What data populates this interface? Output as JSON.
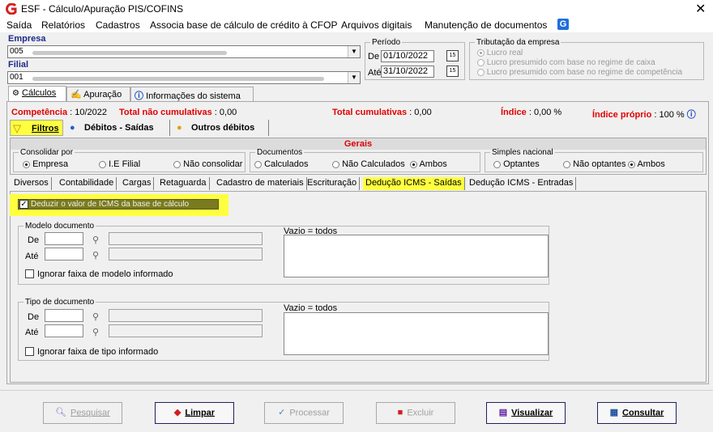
{
  "window": {
    "title": "ESF - Cálculo/Apuração PIS/COFINS",
    "close": "✕"
  },
  "menu": [
    "Saída",
    "Relatórios",
    "Cadastros",
    "Associa base de cálculo de crédito à CFOP",
    "Arquivos digitais",
    "Manutenção de documentos"
  ],
  "empresa": {
    "label": "Empresa",
    "value": "005"
  },
  "filial": {
    "label": "Filial",
    "value": "001"
  },
  "periodo": {
    "legend": "Período",
    "de_label": "De",
    "de_value": "01/10/2022",
    "ate_label": "Até",
    "ate_value": "31/10/2022"
  },
  "tributacao": {
    "legend": "Tributação da empresa",
    "options": [
      "Lucro real",
      "Lucro presumido com base no regime de caixa",
      "Lucro presumido com base no regime de competência"
    ],
    "selected": 0
  },
  "main_tabs": [
    "Cálculos",
    "Apuração",
    "Informações do sistema"
  ],
  "summary": {
    "competencia_label": "Competência",
    "competencia_value": ": 10/2022",
    "tnc_label": "Total não cumulativas",
    "tnc_value": ": 0,00",
    "tc_label": "Total cumulativas",
    "tc_value": ": 0,00",
    "indice_label": "Índice",
    "indice_value": ": 0,00 %",
    "indice_proprio_label": "Índice próprio",
    "indice_proprio_value": ": 100 %"
  },
  "sub_tabs": [
    "Filtros",
    "Débitos - Saídas",
    "Outros débitos"
  ],
  "gerais": {
    "header": "Gerais",
    "consolidar": {
      "legend": "Consolidar por",
      "options": [
        "Empresa",
        "I.E Filial",
        "Não consolidar"
      ],
      "selected": 0
    },
    "documentos": {
      "legend": "Documentos",
      "options": [
        "Calculados",
        "Não Calculados",
        "Ambos"
      ],
      "selected": 2
    },
    "simples": {
      "legend": "Simples nacional",
      "options": [
        "Optantes",
        "Não optantes",
        "Ambos"
      ],
      "selected": 2
    }
  },
  "filter_tabs": [
    "Diversos",
    "Contabilidade",
    "Cargas",
    "Retaguarda",
    "Cadastro de materiais",
    "Escrituração",
    "Dedução ICMS - Saídas",
    "Dedução ICMS - Entradas"
  ],
  "deduzir_checkbox": {
    "label": "Deduzir o valor de ICMS da base de cálculo",
    "checked": true
  },
  "modelo": {
    "legend": "Modelo documento",
    "de": "De",
    "ate": "Até",
    "vazio": "Vazio = todos",
    "ignorar": "Ignorar faixa de modelo informado"
  },
  "tipo": {
    "legend": "Tipo de documento",
    "de": "De",
    "ate": "Até",
    "vazio": "Vazio = todos",
    "ignorar": "Ignorar faixa de tipo informado"
  },
  "buttons": {
    "pesquisar": "Pesquisar",
    "limpar": "Limpar",
    "processar": "Processar",
    "excluir": "Excluir",
    "visualizar": "Visualizar",
    "consultar": "Consultar"
  },
  "colors": {
    "accent_red": "#e00000",
    "highlight": "#ffff40",
    "label_blue": "#1f2a8c"
  }
}
